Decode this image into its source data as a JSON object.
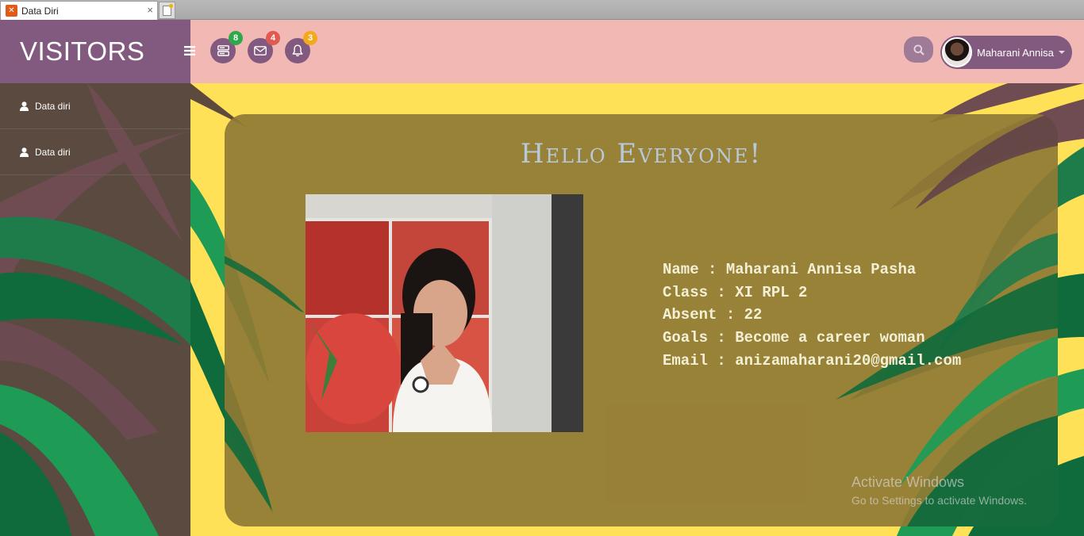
{
  "browser": {
    "tab_title": "Data Diri",
    "tab_close": "×",
    "favicon": "xampp-icon"
  },
  "header": {
    "brand": "VISITORS",
    "badges": [
      {
        "icon": "server-icon",
        "count": "8",
        "color": "#2ea84a"
      },
      {
        "icon": "envelope-icon",
        "count": "4",
        "color": "#e05a4f"
      },
      {
        "icon": "bell-icon",
        "count": "3",
        "color": "#f2a91d"
      }
    ],
    "user_name": "Maharani Annisa"
  },
  "sidebar": {
    "items": [
      {
        "label": "Data diri",
        "icon": "user-icon"
      },
      {
        "label": "Data diri",
        "icon": "user-icon"
      }
    ]
  },
  "card": {
    "title": "Hello Everyone!",
    "info": [
      "Name : Maharani Annisa Pasha",
      "Class : XI RPL 2",
      "Absent : 22",
      "Goals : Become a career woman",
      "Email : anizamaharani20@gmail.com"
    ]
  },
  "watermark": {
    "title": "Activate Windows",
    "subtitle": "Go to Settings to activate Windows."
  },
  "colors": {
    "brand": "#835a7f",
    "topbar": "#f2b8b4",
    "background": "#ffe158",
    "sidebar": "#5a4a3f",
    "card": "#8f7934",
    "leaf_green": "#1e9b55",
    "leaf_dark": "#0f6a3c",
    "leaf_purple": "#7c4c63"
  }
}
